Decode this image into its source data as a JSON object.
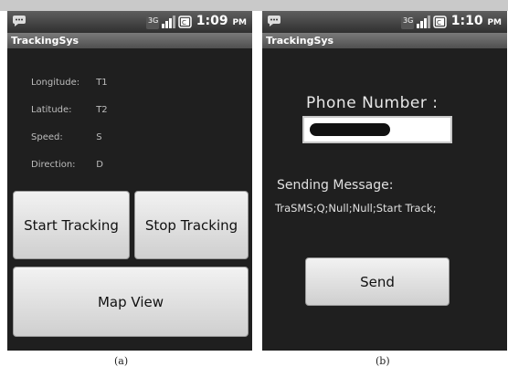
{
  "screen_a": {
    "status": {
      "time": "1:09",
      "ampm": "PM"
    },
    "app_title": "TrackingSys",
    "info": [
      {
        "label": "Longitude:",
        "value": "T1"
      },
      {
        "label": "Latitude:",
        "value": "T2"
      },
      {
        "label": "Speed:",
        "value": "S"
      },
      {
        "label": "Direction:",
        "value": "D"
      }
    ],
    "start_button": "Start Tracking",
    "stop_button": "Stop Tracking",
    "map_button": "Map View",
    "caption": "(a)"
  },
  "screen_b": {
    "status": {
      "time": "1:10",
      "ampm": "PM"
    },
    "app_title": "TrackingSys",
    "phone_label": "Phone Number :",
    "phone_value": "",
    "sending_label": "Sending Message:",
    "sending_message": "TraSMS;Q;Null;Null;Start Track;",
    "send_button": "Send",
    "caption": "(b)"
  },
  "status_icons": [
    "message-icon",
    "3g-icon",
    "signal-icon",
    "battery-icon"
  ]
}
